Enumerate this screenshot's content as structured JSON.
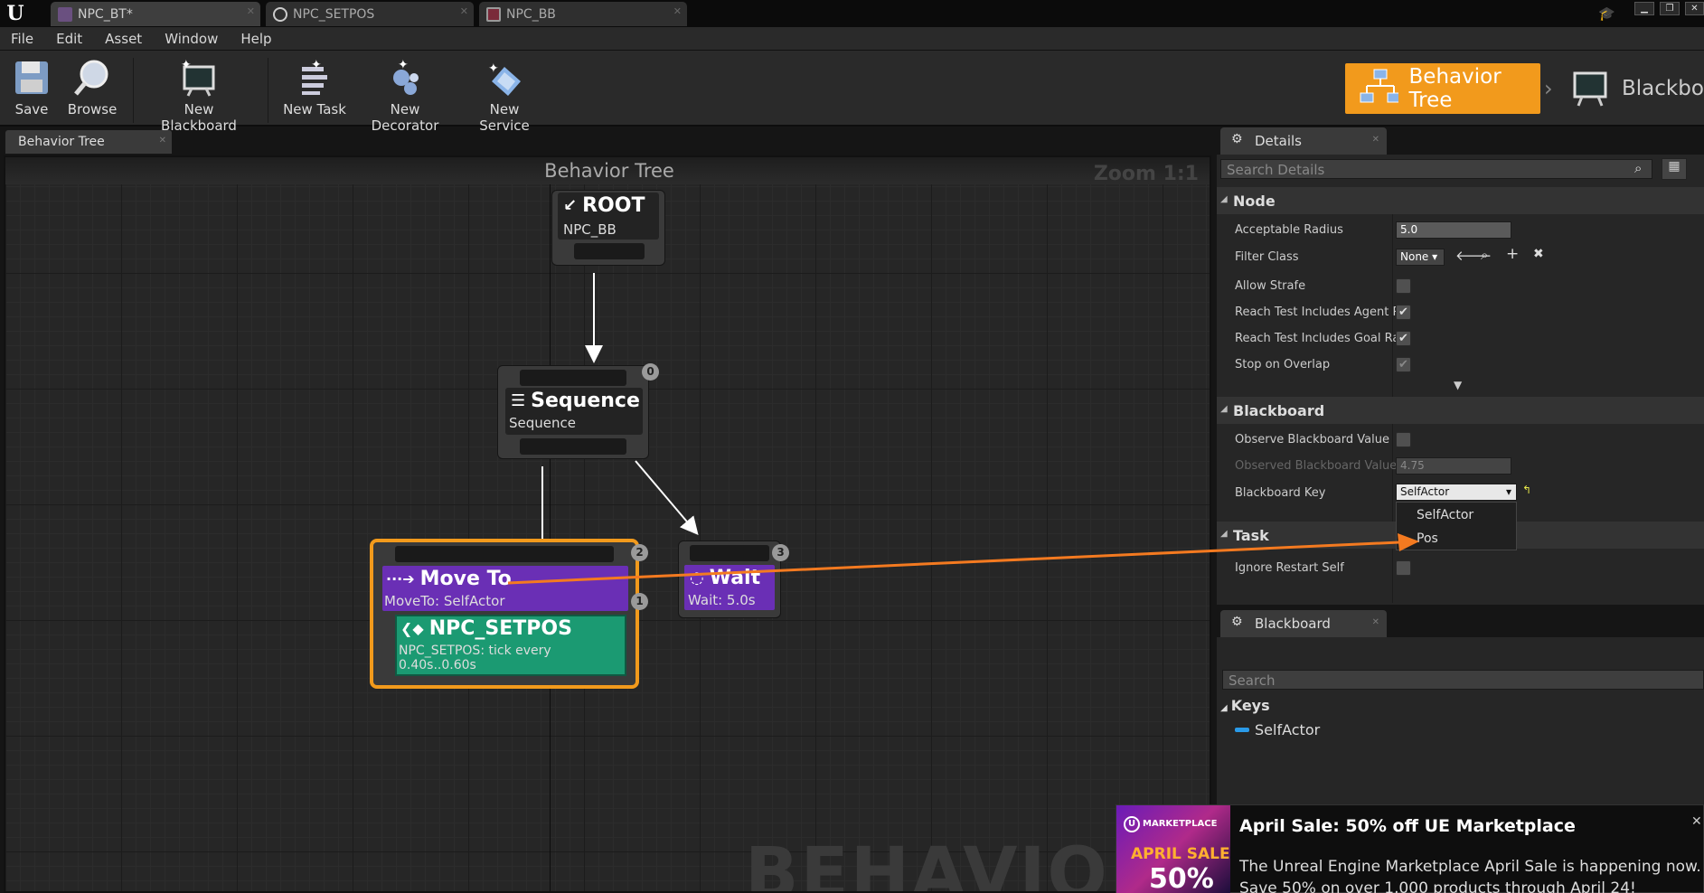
{
  "tabs": [
    {
      "label": "NPC_BT*",
      "icon": "behavior-tree-asset-icon"
    },
    {
      "label": "NPC_SETPOS",
      "icon": "circle-asset-icon"
    },
    {
      "label": "NPC_BB",
      "icon": "blackboard-asset-icon"
    }
  ],
  "menu": [
    "File",
    "Edit",
    "Asset",
    "Window",
    "Help"
  ],
  "toolbar": {
    "save": "Save",
    "browse": "Browse",
    "new_blackboard": "New Blackboard",
    "new_task": "New Task",
    "new_decorator": "New Decorator",
    "new_service": "New Service"
  },
  "modes": {
    "behavior_tree": "Behavior Tree",
    "blackboard": "Blackboard"
  },
  "doc_tab": "Behavior Tree",
  "graph": {
    "title": "Behavior Tree",
    "zoom": "Zoom 1:1",
    "watermark": "BEHAVIOR TREE",
    "nodes": {
      "root": {
        "title": "ROOT",
        "subtitle": "NPC_BB"
      },
      "sequence": {
        "title": "Sequence",
        "subtitle": "Sequence",
        "index": "0"
      },
      "moveto": {
        "title": "Move To",
        "subtitle": "MoveTo: SelfActor",
        "index": "2",
        "sub_index": "1"
      },
      "service": {
        "title": "NPC_SETPOS",
        "subtitle": "NPC_SETPOS: tick every 0.40s..0.60s"
      },
      "wait": {
        "title": "Wait",
        "subtitle": "Wait: 5.0s",
        "index": "3"
      }
    }
  },
  "details": {
    "tab": "Details",
    "search_placeholder": "Search Details",
    "node_section": "Node",
    "acceptable_radius_label": "Acceptable Radius",
    "acceptable_radius": "5.0",
    "filter_class_label": "Filter Class",
    "filter_class": "None",
    "allow_strafe_label": "Allow Strafe",
    "allow_strafe": false,
    "reach_agent_label": "Reach Test Includes Agent Ra",
    "reach_agent": true,
    "reach_goal_label": "Reach Test Includes Goal Rad",
    "reach_goal": true,
    "stop_overlap_label": "Stop on Overlap",
    "stop_overlap": true,
    "blackboard_section": "Blackboard",
    "observe_label": "Observe Blackboard Value",
    "observe": false,
    "observed_tol_label": "Observed Blackboard Value To",
    "observed_tol": "4.75",
    "bb_key_label": "Blackboard Key",
    "bb_key": "SelfActor",
    "dropdown_options": [
      "SelfActor",
      "Pos"
    ],
    "task_section": "Task",
    "ignore_restart_label": "Ignore Restart Self",
    "ignore_restart": false
  },
  "blackboard_panel": {
    "tab": "Blackboard",
    "search_placeholder": "Search",
    "keys_section": "Keys",
    "keys": [
      "SelfActor"
    ]
  },
  "notification": {
    "badge_top": "MARKETPLACE",
    "badge_mid": "APRIL SALE",
    "badge_big": "50%",
    "title": "April Sale: 50% off UE Marketplace",
    "body1": "The Unreal Engine Marketplace April Sale is happening now.",
    "body2": "Save 50% on over 1,000 products through April 24!"
  },
  "colors": {
    "accent_orange": "#f29a1c",
    "task_purple": "#6a2fb5",
    "service_green": "#1b9a72",
    "arrow_orange": "#f47a20"
  }
}
